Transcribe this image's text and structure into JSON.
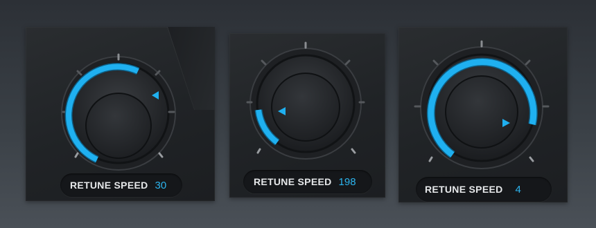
{
  "knobs": [
    {
      "label": "RETUNE SPEED",
      "value": "30"
    },
    {
      "label": "RETUNE SPEED",
      "value": "198"
    },
    {
      "label": "RETUNE SPEED",
      "value": "4"
    }
  ],
  "colors": {
    "accent": "#1fb0f0",
    "value_text": "#2cb4ee",
    "label_text": "#e6e8ea",
    "panel_bg": "#202326",
    "page_bg": "#3a4046"
  },
  "icons": [
    "knob-tick-mark",
    "knob-pointer-triangle"
  ]
}
